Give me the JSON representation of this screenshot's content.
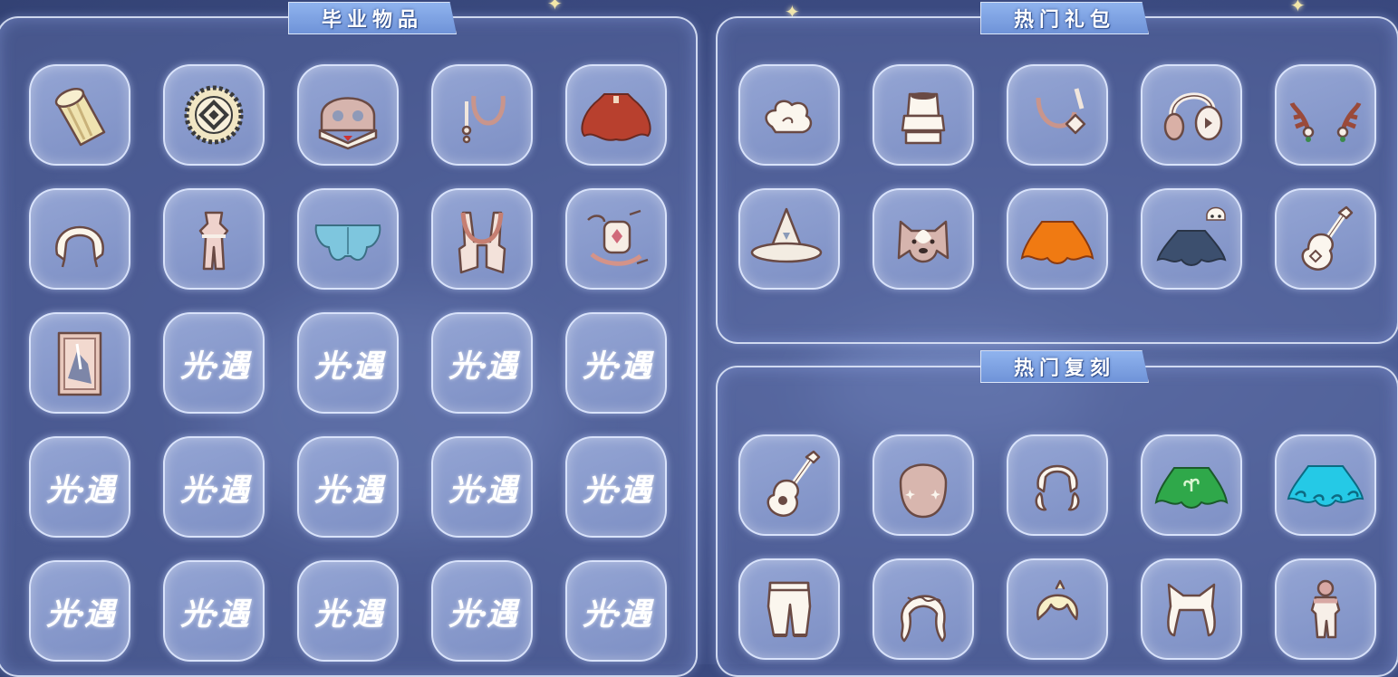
{
  "panels": {
    "graduation": {
      "title": "毕业物品"
    },
    "hot_gifts": {
      "title": "热门礼包"
    },
    "hot_reruns": {
      "title": "热门复刻"
    }
  },
  "placeholder_logo": "光·遇",
  "graduation_items": [
    {
      "icon": "drum-icon"
    },
    {
      "icon": "medallion-icon"
    },
    {
      "icon": "mask-icon"
    },
    {
      "icon": "necklace-icon"
    },
    {
      "icon": "red-cape-icon"
    },
    {
      "icon": "hood-hair-icon"
    },
    {
      "icon": "outfit-icon"
    },
    {
      "icon": "butterfly-cape-icon"
    },
    {
      "icon": "scarf-cape-icon"
    },
    {
      "icon": "spirit-prop-icon"
    },
    {
      "icon": "painting-icon"
    },
    {
      "icon": "locked-placeholder"
    },
    {
      "icon": "locked-placeholder"
    },
    {
      "icon": "locked-placeholder"
    },
    {
      "icon": "locked-placeholder"
    },
    {
      "icon": "locked-placeholder"
    },
    {
      "icon": "locked-placeholder"
    },
    {
      "icon": "locked-placeholder"
    },
    {
      "icon": "locked-placeholder"
    },
    {
      "icon": "locked-placeholder"
    },
    {
      "icon": "locked-placeholder"
    },
    {
      "icon": "locked-placeholder"
    },
    {
      "icon": "locked-placeholder"
    },
    {
      "icon": "locked-placeholder"
    },
    {
      "icon": "locked-placeholder"
    }
  ],
  "gift_items": [
    {
      "icon": "cloud-hair-icon"
    },
    {
      "icon": "fur-hat-icon"
    },
    {
      "icon": "pendant-icon"
    },
    {
      "icon": "headphones-icon"
    },
    {
      "icon": "antlers-icon"
    },
    {
      "icon": "witch-hat-icon"
    },
    {
      "icon": "dog-mask-icon"
    },
    {
      "icon": "orange-cape-icon"
    },
    {
      "icon": "dark-cape-icon"
    },
    {
      "icon": "guitar-icon"
    }
  ],
  "rerun_items": [
    {
      "icon": "ukulele-icon"
    },
    {
      "icon": "blush-mask-icon"
    },
    {
      "icon": "pigtail-hair-icon"
    },
    {
      "icon": "green-cape-icon"
    },
    {
      "icon": "cyan-cape-icon"
    },
    {
      "icon": "pants-icon"
    },
    {
      "icon": "curly-hair-icon"
    },
    {
      "icon": "short-hair-icon"
    },
    {
      "icon": "cat-hair-icon"
    },
    {
      "icon": "doll-outfit-icon"
    }
  ],
  "colors": {
    "background": "#3f4f88",
    "panel_border": "#e6eeff",
    "title_banner": "#7fa3e4",
    "red_cape": "#b8402e",
    "orange_cape": "#f07a12",
    "green_cape": "#2fa84a",
    "cyan_cape": "#25c9e6",
    "butterfly_cape": "#7ec6de",
    "dark_cape": "#3c4f6e",
    "cream": "#f4ecdc",
    "pink_beige": "#e0c3bd"
  }
}
